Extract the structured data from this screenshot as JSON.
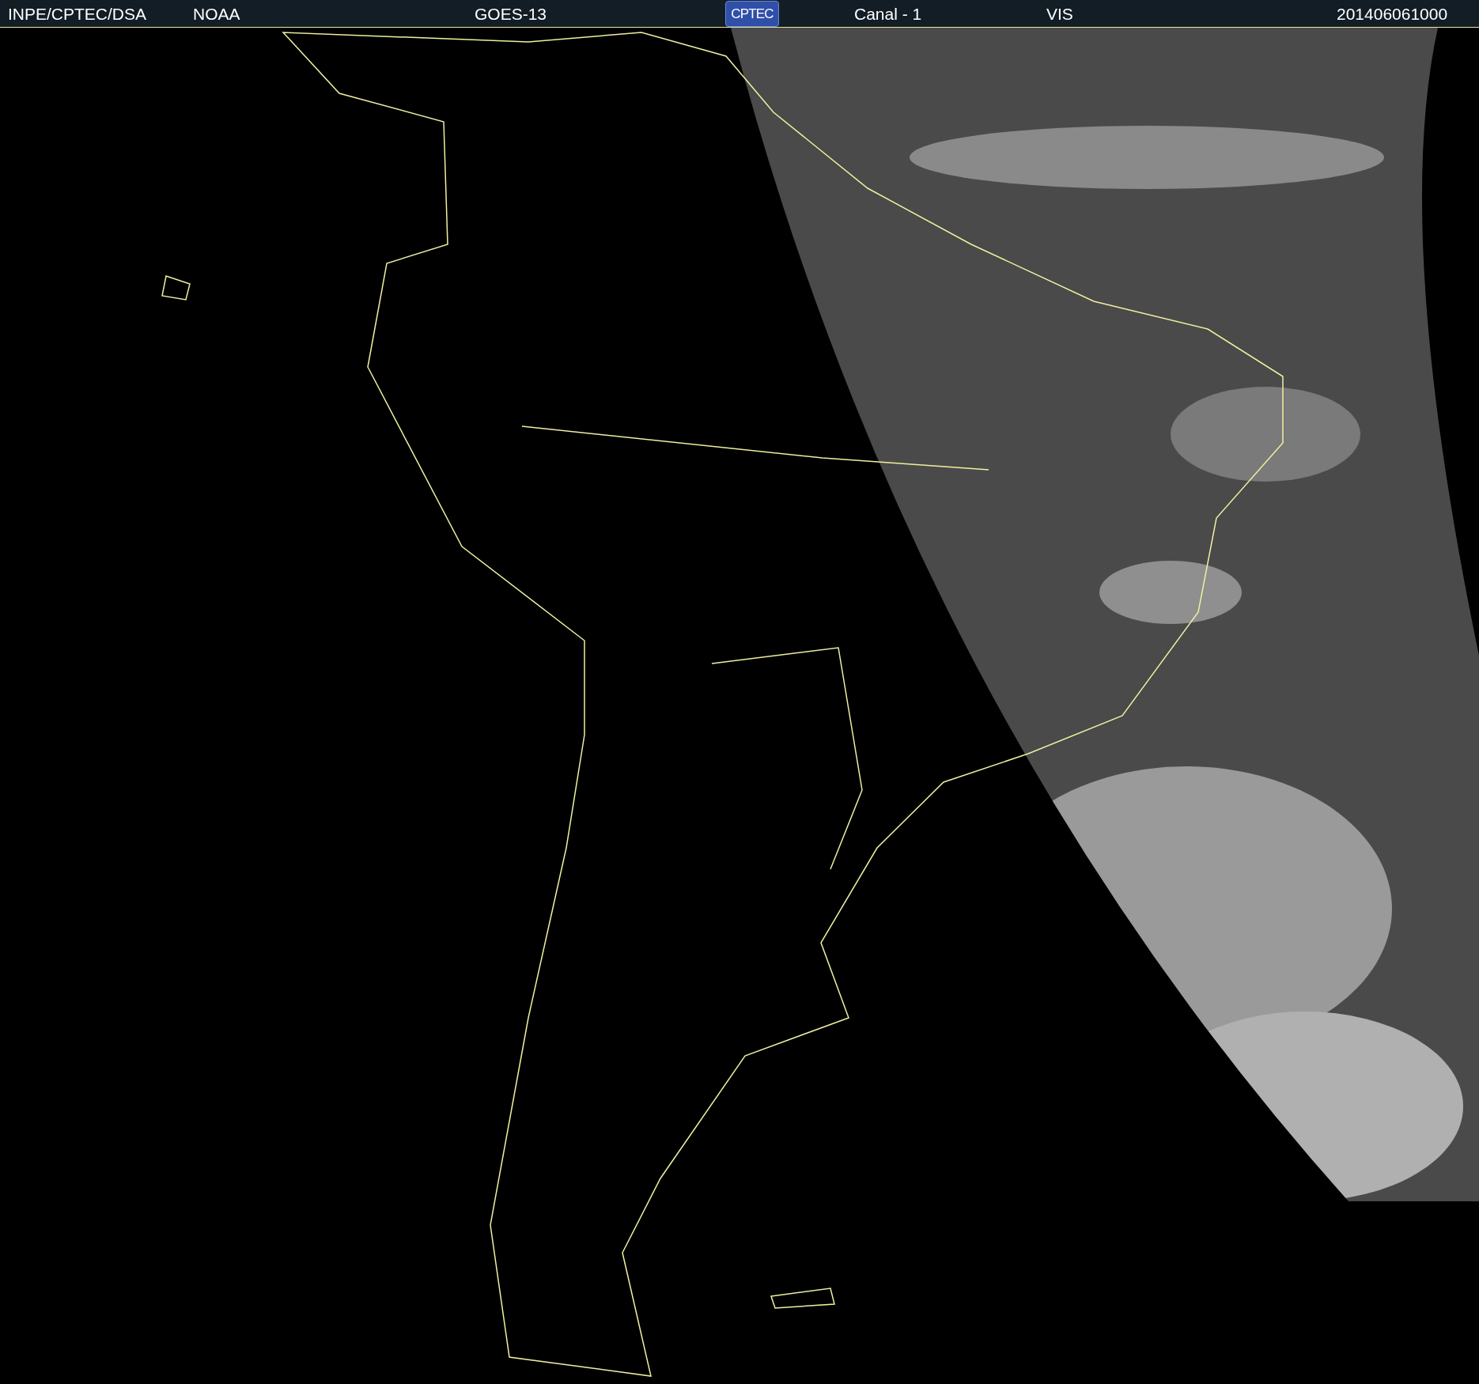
{
  "header": {
    "items": [
      {
        "kind": "text",
        "text": "INPE/CPTEC/DSA"
      },
      {
        "kind": "text",
        "text": "NOAA"
      },
      {
        "kind": "text",
        "text": "GOES-13"
      },
      {
        "kind": "logo",
        "text": "CPTEC"
      },
      {
        "kind": "text",
        "text": "Canal - 1"
      },
      {
        "kind": "text",
        "text": "VIS"
      },
      {
        "kind": "text",
        "text": "201406061000"
      }
    ]
  }
}
